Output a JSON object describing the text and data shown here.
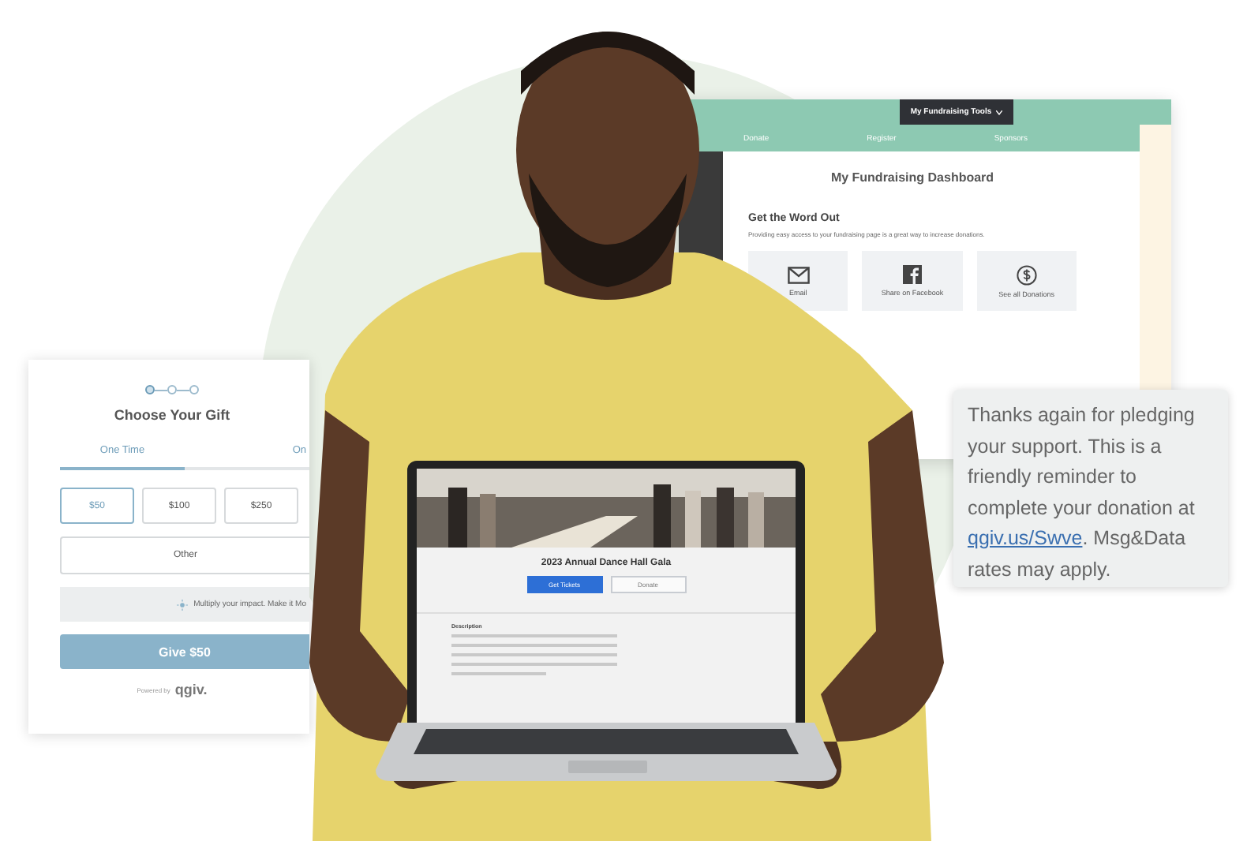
{
  "dashboard": {
    "menu": [
      {
        "label": "My Fundraising Tools",
        "selected": true
      }
    ],
    "nav": [
      "Donate",
      "Register",
      "Sponsors"
    ],
    "title": "My Fundraising Dashboard",
    "section_title": "Get the Word Out",
    "description": "Providing easy access to your fundraising page is a great way to increase donations.",
    "tiles": [
      {
        "kind": "email",
        "label": "Email"
      },
      {
        "kind": "facebook",
        "label": "Share on Facebook"
      },
      {
        "kind": "dollar",
        "label": "See all Donations"
      }
    ]
  },
  "gift_form": {
    "steps": [
      {
        "selected": true
      },
      {
        "selected": false
      },
      {
        "selected": false
      }
    ],
    "title": "Choose Your Gift",
    "tabs": [
      {
        "label": "One Time",
        "selected": true
      },
      {
        "label": "On",
        "selected": false
      }
    ],
    "amounts": [
      {
        "label": "$50",
        "selected": true
      },
      {
        "label": "$100",
        "selected": false
      },
      {
        "label": "$250",
        "selected": false
      }
    ],
    "other": "Other",
    "notice": "Multiply your impact. Make it Mo",
    "submit": "Give $50",
    "powered_by": "Powered by",
    "brand": "qgiv."
  },
  "laptop": {
    "event_title": "2023 Annual Dance Hall Gala",
    "buttons": [
      {
        "label": "Get Tickets",
        "kind": "primary"
      },
      {
        "label": "Donate",
        "kind": "secondary"
      }
    ],
    "description_heading": "Description"
  },
  "sms": {
    "before": "Thanks again for pledging your support. This is a friendly reminder to complete your donation at",
    "link": "qgiv.us/Swve",
    "after": ". Msg&Data rates may apply."
  }
}
